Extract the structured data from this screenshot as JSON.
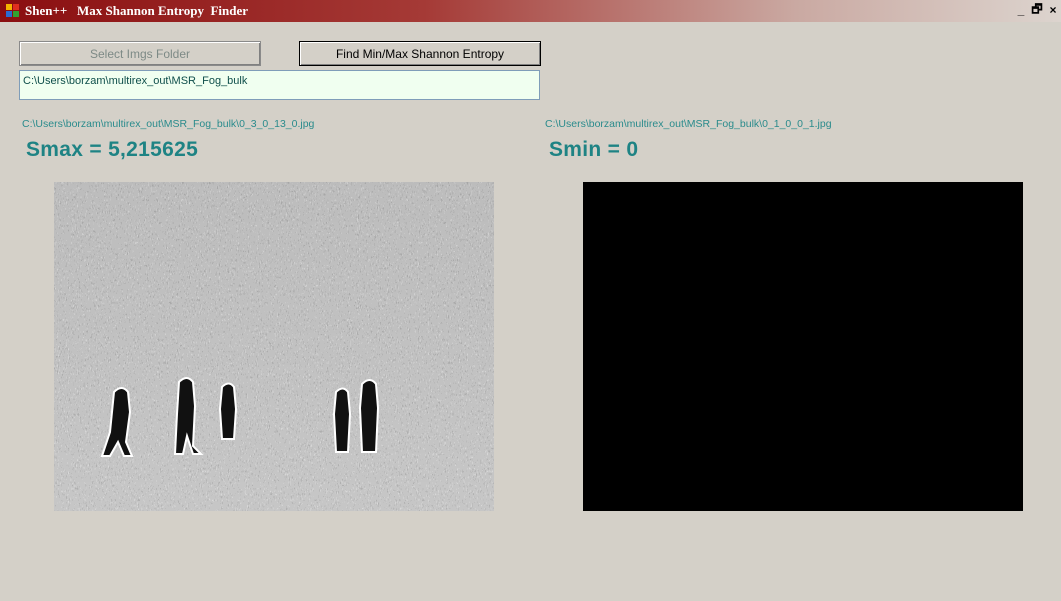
{
  "window": {
    "title": "Shen++   Max Shannon Entropy  Finder",
    "controls": [
      "_",
      "🗗",
      "×"
    ]
  },
  "buttons": {
    "select_folder": "Select Imgs Folder",
    "find_entropy": "Find Min/Max Shannon Entropy"
  },
  "folder_path": "C:\\Users\\borzam\\multirex_out\\MSR_Fog_bulk",
  "max_result": {
    "file": "C:\\Users\\borzam\\multirex_out\\MSR_Fog_bulk\\0_3_0_13_0.jpg",
    "label": "Smax = 5,215625"
  },
  "min_result": {
    "file": "C:\\Users\\borzam\\multirex_out\\MSR_Fog_bulk\\0_1_0_0_1.jpg",
    "label": "Smin = 0"
  }
}
